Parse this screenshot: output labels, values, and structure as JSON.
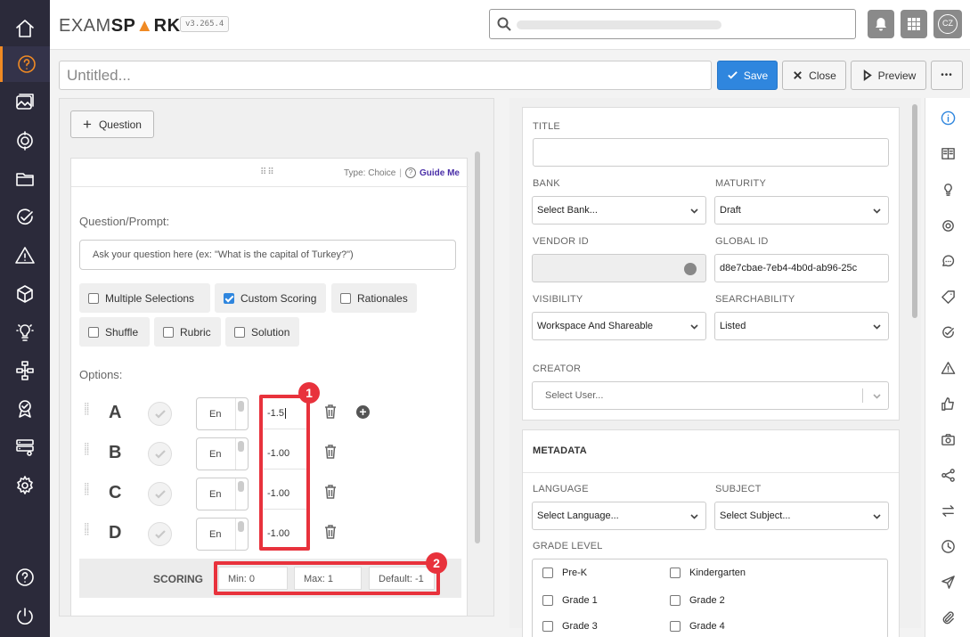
{
  "app": {
    "logo_exam": "EXAM",
    "logo_spark_a": "SP",
    "logo_spark_b": "RK",
    "version": "v3.265.4",
    "avatar_initials": "CZ"
  },
  "sidebar": {
    "items": [
      "home",
      "question",
      "gallery",
      "target",
      "folder",
      "check",
      "warning",
      "cube",
      "lightbulb",
      "flow",
      "badge",
      "server",
      "settings",
      "help",
      "power"
    ],
    "active": "question"
  },
  "title_row": {
    "placeholder": "Untitled...",
    "save": "Save",
    "close": "Close",
    "preview": "Preview",
    "more": "•••"
  },
  "left": {
    "add_question": "Question",
    "drag_dots": "⠿⠿",
    "type_label": "Type: Choice",
    "divider": "|",
    "guide_me": "Guide Me",
    "prompt_label": "Question/Prompt:",
    "prompt_placeholder": "Ask your question here (ex: \"What is the capital of Turkey?\")",
    "checkboxes": [
      {
        "label": "Multiple Selections",
        "checked": false
      },
      {
        "label": "Custom Scoring",
        "checked": true
      },
      {
        "label": "Rationales",
        "checked": false
      },
      {
        "label": "Shuffle",
        "checked": false
      },
      {
        "label": "Rubric",
        "checked": false
      },
      {
        "label": "Solution",
        "checked": false
      }
    ],
    "options_label": "Options:",
    "options": [
      {
        "letter": "A",
        "lang": "En",
        "score": "-1.5"
      },
      {
        "letter": "B",
        "lang": "En",
        "score": "-1.00"
      },
      {
        "letter": "C",
        "lang": "En",
        "score": "-1.00"
      },
      {
        "letter": "D",
        "lang": "En",
        "score": "-1.00"
      }
    ],
    "scoring": {
      "label": "SCORING",
      "min": "Min: 0",
      "max": "Max: 1",
      "default": "Default: -1"
    },
    "badges": [
      "1",
      "2"
    ],
    "highlight_color": "#e8323c"
  },
  "right": {
    "title_label": "TITLE",
    "bank_label": "BANK",
    "bank_value": "Select Bank...",
    "maturity_label": "MATURITY",
    "maturity_value": "Draft",
    "vendor_label": "VENDOR ID",
    "global_label": "GLOBAL ID",
    "global_value": "d8e7cbae-7eb4-4b0d-ab96-25c",
    "visibility_label": "VISIBILITY",
    "visibility_value": "Workspace And Shareable",
    "searchability_label": "SEARCHABILITY",
    "searchability_value": "Listed",
    "creator_label": "CREATOR",
    "creator_placeholder": "Select User...",
    "metadata_title": "METADATA",
    "language_label": "LANGUAGE",
    "language_value": "Select Language...",
    "subject_label": "SUBJECT",
    "subject_value": "Select Subject...",
    "grade_label": "GRADE LEVEL",
    "grades": [
      "Pre-K",
      "Kindergarten",
      "Grade 1",
      "Grade 2",
      "Grade 3",
      "Grade 4"
    ]
  },
  "right_strip": [
    "info",
    "book",
    "lightbulb",
    "target",
    "chat",
    "tag",
    "check",
    "warning",
    "thumbs-up",
    "camera",
    "share",
    "swap",
    "clock",
    "send",
    "paperclip"
  ],
  "colors": {
    "accent": "#2f86de",
    "brand_orange": "#f08a24",
    "sidebar_bg": "#2b2a3a"
  }
}
